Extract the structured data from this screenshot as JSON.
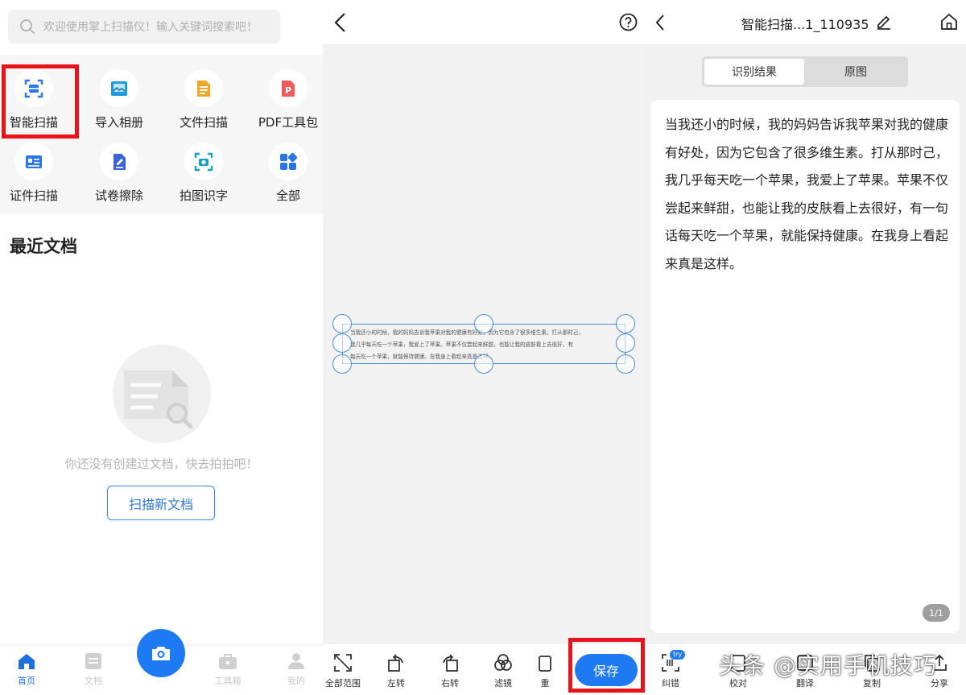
{
  "colors": {
    "accent": "#1e7af2",
    "highlight": "#e8141a"
  },
  "home": {
    "search": {
      "placeholder": "欢迎使用掌上扫描仪！输入关键词搜索吧！"
    },
    "tools": [
      {
        "label": "智能扫描",
        "icon": "smart-scan-icon"
      },
      {
        "label": "导入相册",
        "icon": "album-import-icon"
      },
      {
        "label": "文件扫描",
        "icon": "file-scan-icon"
      },
      {
        "label": "PDF工具包",
        "icon": "pdf-icon"
      },
      {
        "label": "证件扫描",
        "icon": "id-card-icon"
      },
      {
        "label": "试卷擦除",
        "icon": "paper-erase-icon"
      },
      {
        "label": "拍图识字",
        "icon": "photo-ocr-icon"
      },
      {
        "label": "全部",
        "icon": "grid-icon"
      }
    ],
    "recent_title": "最近文档",
    "empty_text": "你还没有创建过文档，快去拍拍吧！",
    "scan_new_label": "扫描新文档",
    "nav": [
      {
        "label": "首页",
        "icon": "home-icon"
      },
      {
        "label": "文档",
        "icon": "document-icon"
      },
      {
        "label": "工具箱",
        "icon": "toolbox-icon"
      },
      {
        "label": "我的",
        "icon": "profile-icon"
      }
    ]
  },
  "crop": {
    "preview_lines": [
      "当我还小的时候，我的妈妈告诉我苹果对我的健康有好处，因为它包含了很多维生素。打从那时己，",
      "我几乎每天吃一个苹果，我爱上了苹果。苹果不仅尝起来鲜甜，也能让我的皮肤看上去很好，有",
      "每天吃一个苹果，就能保持健康。在我身上看起来真是这样。"
    ],
    "toolbar": [
      {
        "label": "全部范围",
        "icon": "expand-icon"
      },
      {
        "label": "左转",
        "icon": "rotate-left-icon"
      },
      {
        "label": "右转",
        "icon": "rotate-right-icon"
      },
      {
        "label": "滤镜",
        "icon": "filter-icon"
      },
      {
        "label": "重",
        "icon": "retake-icon"
      }
    ],
    "save_label": "保存"
  },
  "result": {
    "title": "智能扫描...1_110935",
    "tabs": [
      {
        "label": "识别结果",
        "active": true
      },
      {
        "label": "原图",
        "active": false
      }
    ],
    "text": "当我还小的时候，我的妈妈告诉我苹果对我的健康有好处，因为它包含了很多维生素。打从那时己，我几乎每天吃一个苹果，我爱上了苹果。苹果不仅尝起来鲜甜，也能让我的皮肤看上去很好，有一句话每天吃一个苹果，就能保持健康。在我身上看起来真是这样。",
    "page_indicator": "1/1",
    "toolbar": [
      {
        "label": "纠错",
        "icon": "correction-icon",
        "badge": "try"
      },
      {
        "label": "校对",
        "icon": "proofread-icon"
      },
      {
        "label": "翻译",
        "icon": "translate-icon"
      },
      {
        "label": "复制",
        "icon": "copy-icon"
      },
      {
        "label": "分享",
        "icon": "share-icon"
      }
    ],
    "watermark": "头条 @实用手机技巧"
  }
}
